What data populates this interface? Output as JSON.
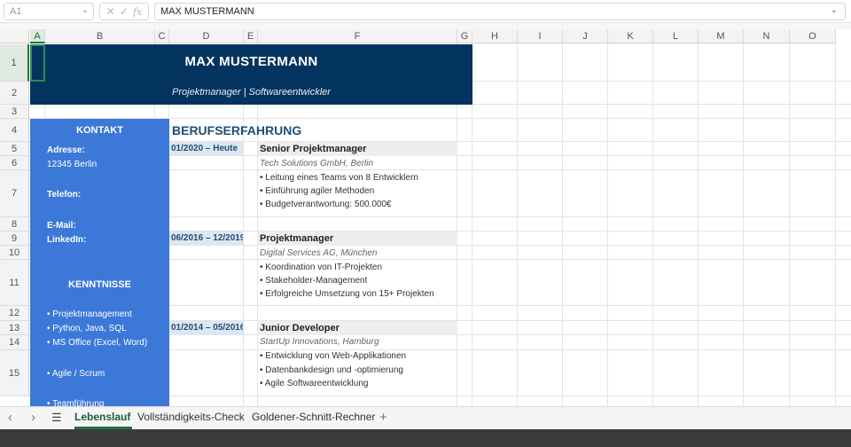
{
  "formula_bar": {
    "name_box": "A1",
    "fx_icons": [
      "✕",
      "✓",
      "fx"
    ],
    "value": "MAX MUSTERMANN"
  },
  "columns": [
    "A",
    "B",
    "C",
    "D",
    "E",
    "F",
    "G",
    "H",
    "I",
    "J",
    "K",
    "L",
    "M",
    "N",
    "O"
  ],
  "rows": [
    "1",
    "2",
    "3",
    "4",
    "5",
    "6",
    "7",
    "8",
    "9",
    "10",
    "11",
    "12",
    "13",
    "14",
    "15"
  ],
  "colors": {
    "header_navy": "#03345f",
    "sidebar_blue": "#3c78d8",
    "accent_green": "#1e7145",
    "date_fill": "#dde7f1",
    "title_fill": "#eeeeee"
  },
  "header": {
    "name": "MAX MUSTERMANN",
    "subtitle": "Projektmanager | Softwareentwickler"
  },
  "sidebar": {
    "kontakt_title": "KONTAKT",
    "address_label": "Adresse:",
    "address_value": "12345 Berlin",
    "phone_label": "Telefon:",
    "email_label": "E-Mail:",
    "linkedin_label": "LinkedIn:",
    "skills_title": "KENNTNISSE",
    "skills": [
      "• Projektmanagement",
      "• Python, Java, SQL",
      "• MS Office (Excel, Word)",
      "• Agile / Scrum",
      "• Teamführung"
    ]
  },
  "experience": {
    "title": "BERUFSERFAHRUNG",
    "jobs": [
      {
        "period": "01/2020 – Heute",
        "position": "Senior Projektmanager",
        "company": "Tech Solutions GmbH, Berlin",
        "bullets": [
          "• Leitung eines Teams von 8 Entwicklern",
          "• Einführung agiler Methoden",
          "• Budgetverantwortung: 500.000€"
        ]
      },
      {
        "period": "06/2016 – 12/2019",
        "position": "Projektmanager",
        "company": "Digital Services AG, München",
        "bullets": [
          "• Koordination von IT-Projekten",
          "• Stakeholder-Management",
          "• Erfolgreiche Umsetzung von 15+ Projekten"
        ]
      },
      {
        "period": "01/2014 – 05/2016",
        "position": "Junior Developer",
        "company": "StartUp Innovations, Hamburg",
        "bullets": [
          "• Entwicklung von Web-Applikationen",
          "• Datenbankdesign und -optimierung",
          "• Agile Softwareentwicklung"
        ]
      }
    ]
  },
  "sheet_tabs": {
    "nav_prev": "‹",
    "nav_next": "›",
    "menu_icon": "☰",
    "tabs": [
      "Lebenslauf",
      "Vollständigkeits-Check",
      "Goldener-Schnitt-Rechner"
    ],
    "active_tab": "Lebenslauf",
    "add_icon": "+"
  }
}
